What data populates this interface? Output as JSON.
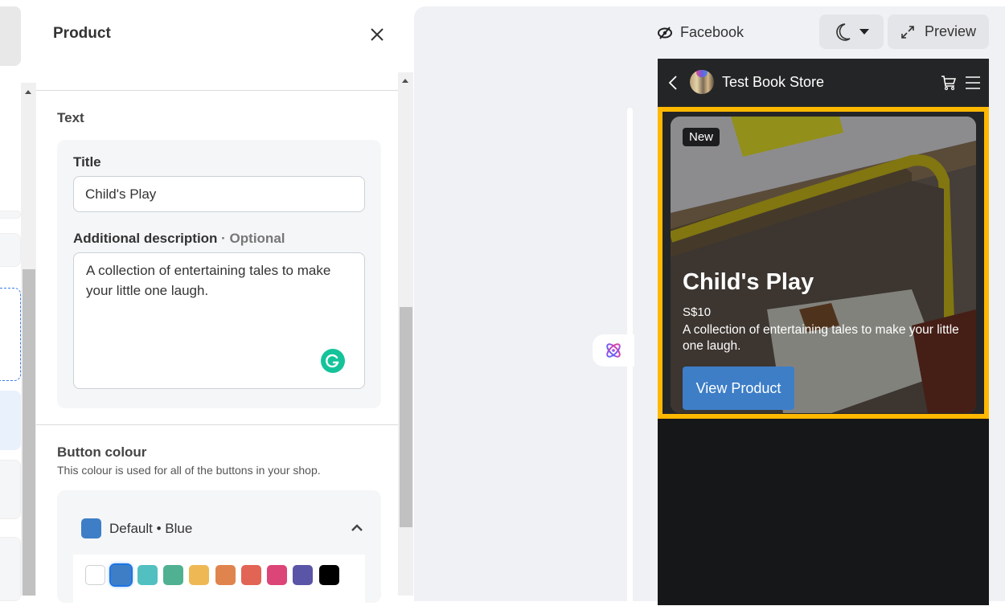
{
  "panel": {
    "title": "Product",
    "text_section": {
      "heading": "Text",
      "title_label": "Title",
      "title_value": "Child's Play",
      "description_label": "Additional description",
      "description_optional": " · Optional",
      "description_value": "A collection of entertaining tales to make your little one laugh."
    },
    "button_colour": {
      "heading": "Button colour",
      "subtext": "This colour is used for all of the buttons in your shop.",
      "selected_label": "Default • Blue",
      "selected_color": "#3d7ec7",
      "swatches": [
        {
          "name": "white",
          "color": "#ffffff"
        },
        {
          "name": "blue",
          "color": "#3d7ec7",
          "selected": true
        },
        {
          "name": "teal",
          "color": "#52c0c0"
        },
        {
          "name": "green",
          "color": "#50b092"
        },
        {
          "name": "yellow",
          "color": "#eeb955"
        },
        {
          "name": "orange",
          "color": "#e0844e"
        },
        {
          "name": "red",
          "color": "#e26455"
        },
        {
          "name": "pink",
          "color": "#dc4577"
        },
        {
          "name": "purple",
          "color": "#5b55a7"
        },
        {
          "name": "black",
          "color": "#000000"
        }
      ]
    }
  },
  "preview": {
    "platform_label": "Facebook",
    "preview_button": "Preview",
    "store_name": "Test Book Store",
    "product": {
      "badge": "New",
      "title": "Child's Play",
      "price": "S$10",
      "description": "A collection of entertaining tales to make your little one laugh.",
      "cta": "View Product"
    },
    "highlight_color": "#ffb800"
  }
}
